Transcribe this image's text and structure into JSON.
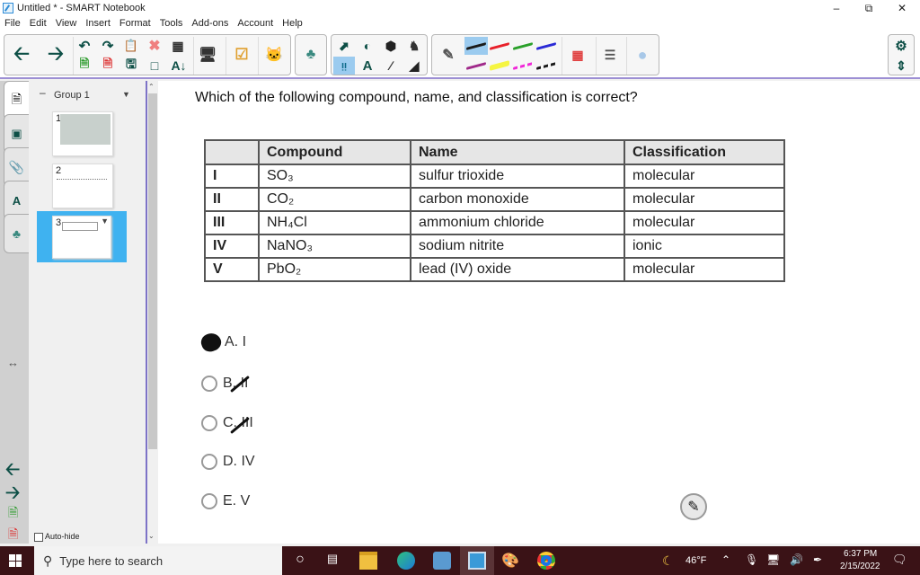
{
  "window": {
    "title": "Untitled * - SMART Notebook",
    "controls": [
      "minimize",
      "restore",
      "close"
    ]
  },
  "menu": [
    "File",
    "Edit",
    "View",
    "Insert",
    "Format",
    "Tools",
    "Add-ons",
    "Account",
    "Help"
  ],
  "toolbar": {
    "nav": [
      "back-arrow-icon",
      "forward-arrow-icon"
    ],
    "file_tools": [
      "undo-icon",
      "redo-icon",
      "paste-icon",
      "delete-icon",
      "table-icon",
      "add-page-icon",
      "delete-page-icon",
      "save-icon",
      "screen-shade-icon",
      "text-recognition-icon"
    ],
    "pen_colors": [
      "#1a1a1a",
      "#e8202a",
      "#2aa02a",
      "#2b2bd6",
      "#a02a8a",
      "#f5f542",
      "#f028d8",
      "#1a1a1a"
    ],
    "active_pen_index": 0
  },
  "sidebar": {
    "group_label": "Group 1",
    "pages": [
      {
        "number": "1"
      },
      {
        "number": "2"
      },
      {
        "number": "3",
        "selected": true
      }
    ],
    "auto_hide_label": "Auto-hide",
    "auto_hide_checked": false
  },
  "page": {
    "question": "Which of the following compound, name, and classification is correct?",
    "table": {
      "headers": [
        "",
        "Compound",
        "Name",
        "Classification"
      ],
      "rows": [
        [
          "I",
          "SO₃",
          "sulfur trioxide",
          "molecular"
        ],
        [
          "II",
          "CO₂",
          "carbon monoxide",
          "molecular"
        ],
        [
          "III",
          "NH₄Cl",
          "ammonium chloride",
          "molecular"
        ],
        [
          "IV",
          "NaNO₃",
          "sodium nitrite",
          "ionic"
        ],
        [
          "V",
          "PbO₂",
          "lead (IV) oxide",
          "molecular"
        ]
      ]
    },
    "options": [
      {
        "label": "A. I",
        "marked": "filled"
      },
      {
        "label": "B. II",
        "marked": "crossed"
      },
      {
        "label": "C. III",
        "marked": "crossed"
      },
      {
        "label": "D. IV",
        "marked": "none"
      },
      {
        "label": "E. V",
        "marked": "none"
      }
    ]
  },
  "taskbar": {
    "search_placeholder": "Type here to search",
    "weather": "46°F",
    "time": "6:37 PM",
    "date": "2/15/2022"
  }
}
